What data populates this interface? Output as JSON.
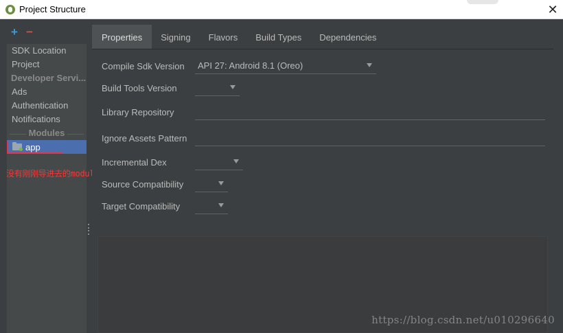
{
  "window": {
    "title": "Project Structure",
    "close_glyph": "✕"
  },
  "sidebar": {
    "toolbar": {
      "add_glyph": "+",
      "remove_glyph": "−"
    },
    "items_top": [
      {
        "label": "SDK Location"
      },
      {
        "label": "Project"
      }
    ],
    "developer_header": "Developer Servi...",
    "items_dev": [
      {
        "label": "Ads"
      },
      {
        "label": "Authentication"
      },
      {
        "label": "Notifications"
      }
    ],
    "modules_header": "Modules",
    "module": {
      "label": "app",
      "icon": "module-folder-icon"
    }
  },
  "annotation": "没有刚刚导进去的module",
  "tabs": [
    {
      "label": "Properties",
      "active": true
    },
    {
      "label": "Signing"
    },
    {
      "label": "Flavors"
    },
    {
      "label": "Build Types"
    },
    {
      "label": "Dependencies"
    }
  ],
  "form": {
    "compile_sdk": {
      "label": "Compile Sdk Version",
      "value": "API 27: Android 8.1 (Oreo)"
    },
    "build_tools": {
      "label": "Build Tools Version",
      "value": ""
    },
    "library_repo": {
      "label": "Library Repository",
      "value": ""
    },
    "ignore_assets": {
      "label": "Ignore Assets Pattern",
      "value": ""
    },
    "incremental_dex": {
      "label": "Incremental Dex",
      "value": ""
    },
    "source_compat": {
      "label": "Source Compatibility",
      "value": ""
    },
    "target_compat": {
      "label": "Target Compatibility",
      "value": ""
    }
  },
  "watermark": "https://blog.csdn.net/u010296640",
  "colors": {
    "background": "#3c3f41",
    "sidebar": "#45494a",
    "selection": "#4b6eaf",
    "annotation": "#ff3333",
    "add": "#3d9bd3",
    "remove": "#c75450"
  }
}
